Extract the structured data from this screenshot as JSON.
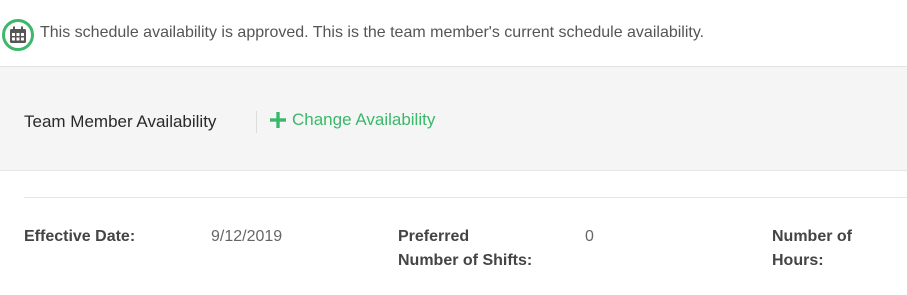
{
  "notice": {
    "icon": "calendar-icon",
    "text": "This schedule availability is approved. This is the team member's current schedule availability."
  },
  "header": {
    "title": "Team Member Availability",
    "change_button": {
      "icon": "plus-icon",
      "label": "Change Availability"
    }
  },
  "details": {
    "effective_date": {
      "label": "Effective Date:",
      "value": "9/12/2019"
    },
    "preferred_shifts": {
      "label_line1": "Preferred",
      "label_line2": "Number of Shifts:",
      "value": "0"
    },
    "number_of_hours": {
      "label_line1": "Number of",
      "label_line2": "Hours:"
    }
  },
  "colors": {
    "accent": "#3bb86a",
    "band": "#f5f5f5"
  }
}
